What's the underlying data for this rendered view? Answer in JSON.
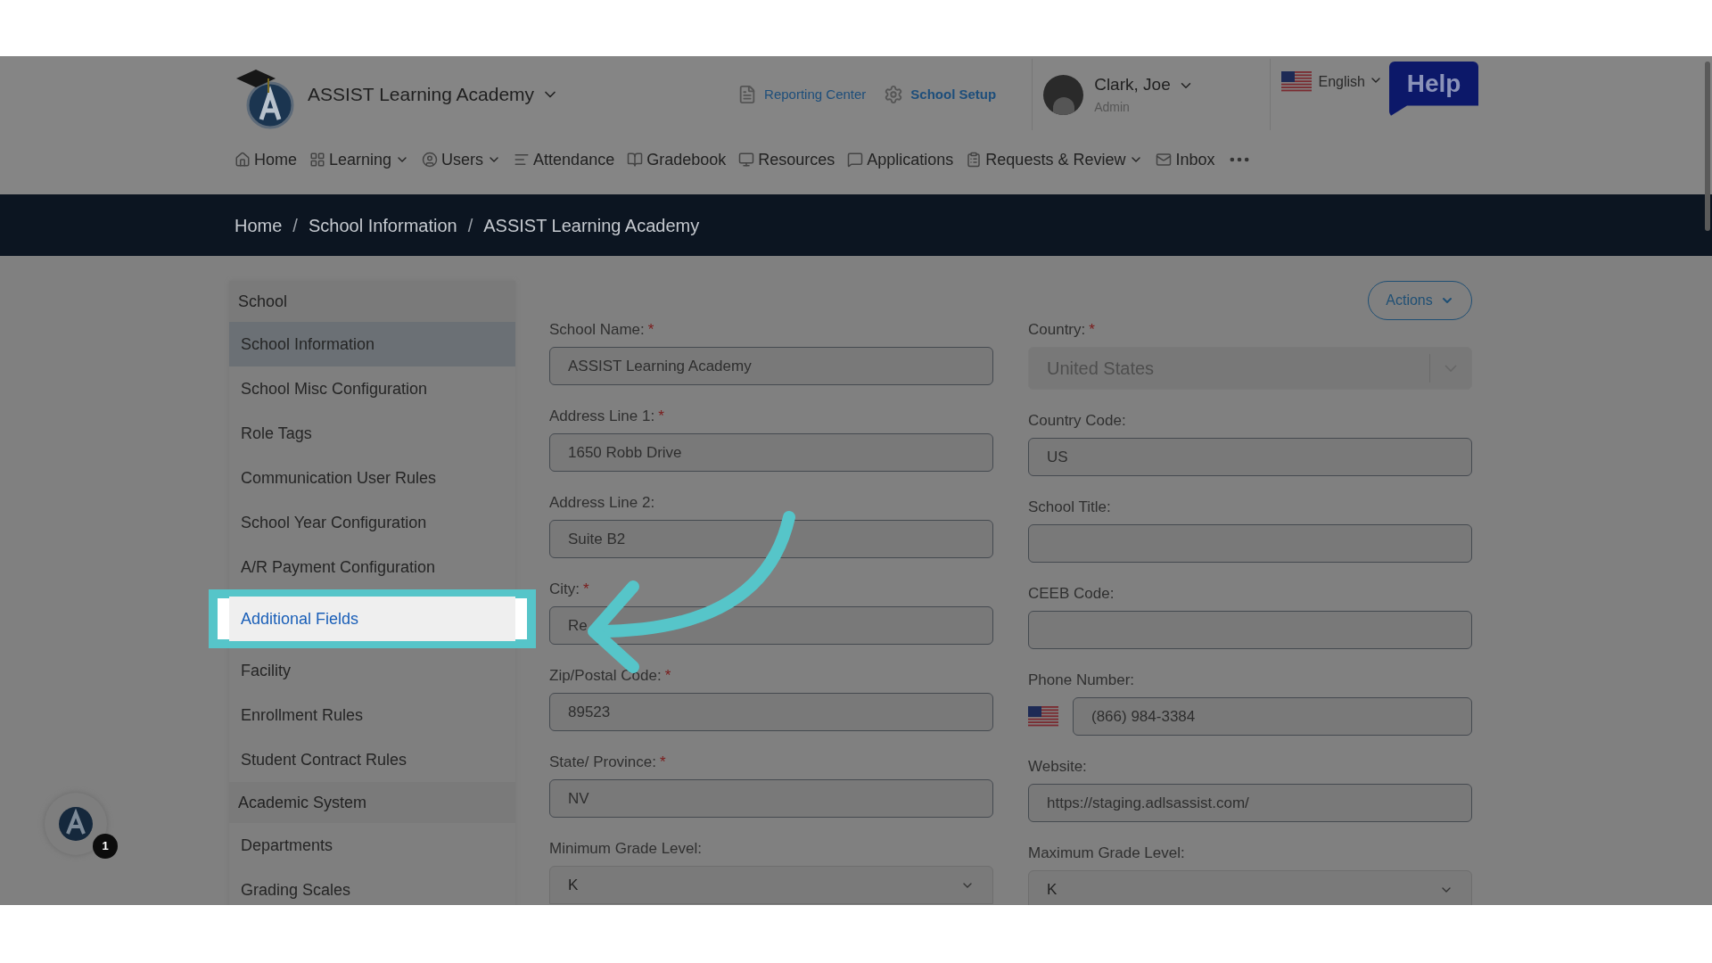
{
  "header": {
    "school": "ASSIST Learning Academy",
    "links": [
      {
        "label": "Reporting Center",
        "kind": "report"
      },
      {
        "label": "School Setup",
        "kind": "setup"
      }
    ],
    "user": {
      "name": "Clark, Joe",
      "role": "Admin"
    },
    "language": "English",
    "help": "Help"
  },
  "nav": [
    {
      "label": "Home",
      "caret": false
    },
    {
      "label": "Learning",
      "caret": true
    },
    {
      "label": "Users",
      "caret": true
    },
    {
      "label": "Attendance",
      "caret": false
    },
    {
      "label": "Gradebook",
      "caret": false
    },
    {
      "label": "Resources",
      "caret": false
    },
    {
      "label": "Applications",
      "caret": false
    },
    {
      "label": "Requests & Review",
      "caret": true
    },
    {
      "label": "Inbox",
      "caret": false
    }
  ],
  "breadcrumb": [
    {
      "kind": "link",
      "text": "Home"
    },
    {
      "kind": "separator",
      "text": "/"
    },
    {
      "kind": "link",
      "text": "School Information"
    },
    {
      "kind": "separator",
      "text": "/"
    },
    {
      "kind": "link",
      "text": "ASSIST Learning Academy"
    }
  ],
  "sidebar": [
    {
      "label": "School",
      "kind": "header"
    },
    {
      "label": "School Information",
      "kind": "item",
      "selected": true,
      "highlighted": false
    },
    {
      "label": "School Misc Configuration",
      "kind": "item",
      "selected": false,
      "highlighted": false
    },
    {
      "label": "Role Tags",
      "kind": "item",
      "selected": false,
      "highlighted": false
    },
    {
      "label": "Communication User Rules",
      "kind": "item",
      "selected": false,
      "highlighted": false
    },
    {
      "label": "School Year Configuration",
      "kind": "item",
      "selected": false,
      "highlighted": false
    },
    {
      "label": "A/R Payment Configuration",
      "kind": "item",
      "selected": false,
      "highlighted": false
    },
    {
      "label": "Additional Fields",
      "kind": "item",
      "selected": false,
      "highlighted": true
    },
    {
      "label": "Facility",
      "kind": "item",
      "selected": false,
      "highlighted": false
    },
    {
      "label": "Enrollment Rules",
      "kind": "item",
      "selected": false,
      "highlighted": false
    },
    {
      "label": "Student Contract Rules",
      "kind": "item",
      "selected": false,
      "highlighted": false
    },
    {
      "label": "Academic System",
      "kind": "header"
    },
    {
      "label": "Departments",
      "kind": "item",
      "selected": false,
      "highlighted": false
    },
    {
      "label": "Grading Scales",
      "kind": "item",
      "selected": false,
      "highlighted": false
    }
  ],
  "actions": "Actions",
  "form_left": [
    {
      "label": "School Name:",
      "required_mark": "*",
      "kind": "text",
      "value": "ASSIST Learning Academy"
    },
    {
      "label": "Address Line 1:",
      "required_mark": "*",
      "kind": "text",
      "value": "1650 Robb Drive"
    },
    {
      "label": "Address Line 2:",
      "kind": "text",
      "value": "Suite B2"
    },
    {
      "label": "City:",
      "required_mark": "*",
      "kind": "text",
      "value": "Re"
    },
    {
      "label": "Zip/Postal Code:",
      "required_mark": "*",
      "kind": "text",
      "value": "89523"
    },
    {
      "label": "State/ Province:",
      "required_mark": "*",
      "kind": "text",
      "value": "NV"
    },
    {
      "label": "Minimum Grade Level:",
      "kind": "select",
      "value": "K"
    }
  ],
  "form_right": [
    {
      "label": "Country:",
      "required_mark": "*",
      "kind": "disabled-select",
      "value": "United States"
    },
    {
      "label": "Country Code:",
      "kind": "text",
      "value": "US"
    },
    {
      "label": "School Title:",
      "kind": "text"
    },
    {
      "label": "CEEB Code:",
      "kind": "text"
    },
    {
      "label": "Phone Number:",
      "kind": "phone",
      "value": "(866) 984-3384"
    },
    {
      "label": "Website:",
      "kind": "text",
      "value": "https://staging.adlsassist.com/"
    },
    {
      "label": "Maximum Grade Level:",
      "kind": "select",
      "value": "K"
    }
  ],
  "chat_badge": "1"
}
